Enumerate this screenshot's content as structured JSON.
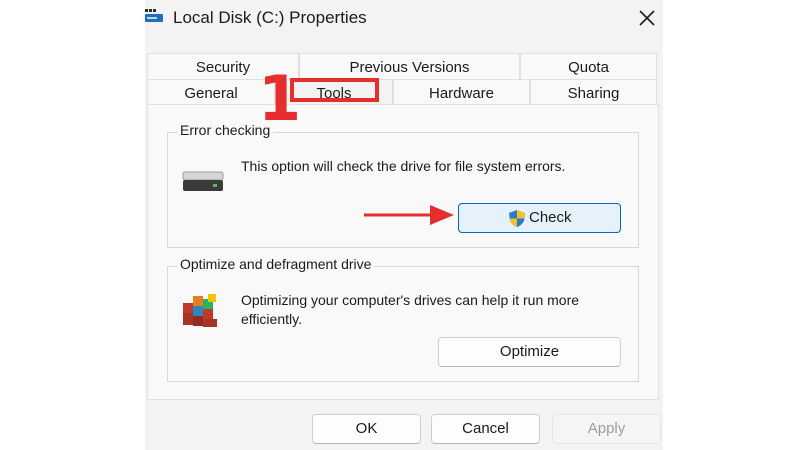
{
  "window": {
    "title": "Local Disk (C:) Properties",
    "icon": "drive-app-icon",
    "close_icon": "close-icon"
  },
  "tabs": {
    "top_row": [
      "Security",
      "Previous Versions",
      "Quota"
    ],
    "bottom_row": [
      "General",
      "Tools",
      "Hardware",
      "Sharing"
    ],
    "active": "Tools"
  },
  "error_checking": {
    "title": "Error checking",
    "description": "This option will check the drive for file system errors.",
    "button_label": "Check",
    "icon": "drive-icon",
    "button_icon": "uac-shield-icon"
  },
  "optimize": {
    "title": "Optimize and defragment drive",
    "description": "Optimizing your computer's drives can help it run more efficiently.",
    "button_label": "Optimize",
    "icon": "defrag-icon"
  },
  "footer": {
    "ok_label": "OK",
    "cancel_label": "Cancel",
    "apply_label": "Apply"
  },
  "annotation": {
    "step_number": "1",
    "color": "#e62e2e"
  },
  "colors": {
    "dialog_bg": "#f3f3f3",
    "panel_bg": "#f9f9f9",
    "accent": "#0067c0"
  }
}
